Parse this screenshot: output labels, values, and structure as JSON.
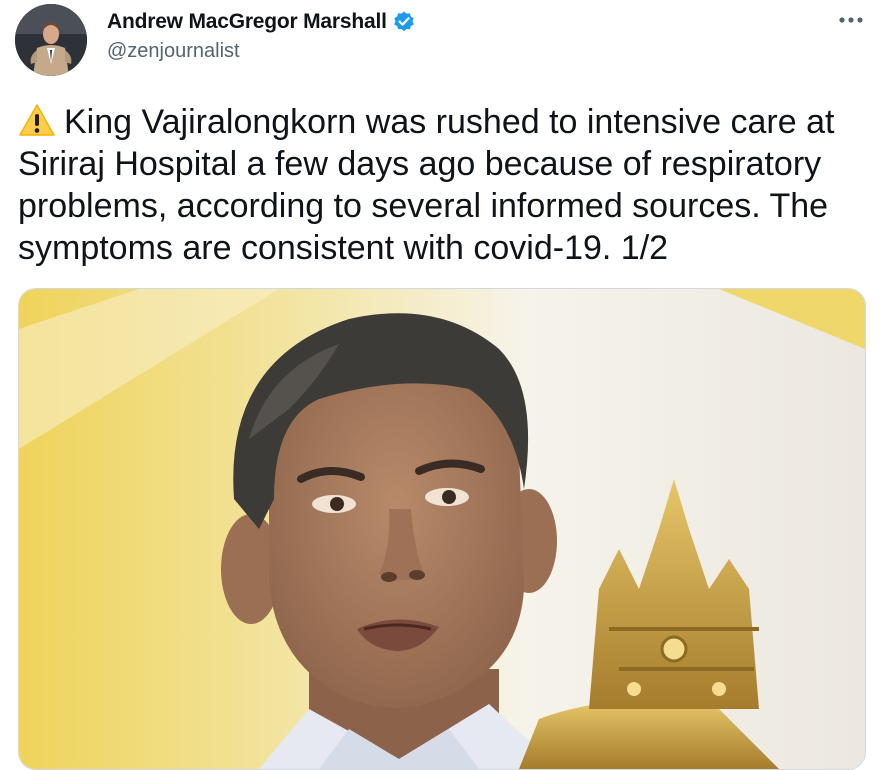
{
  "author": {
    "display_name": "Andrew MacGregor Marshall",
    "handle": "@zenjournalist",
    "verified": true,
    "avatar_icon": "profile-photo-man-in-suit"
  },
  "menu": {
    "more_icon": "more-horizontal-icon"
  },
  "tweet": {
    "warning_emoji": "warning-sign-icon",
    "text": "King Vajiralongkorn was rushed to intensive care at Siriraj Hospital a few days ago because of respiratory problems, according to several informed sources. The symptoms are consistent with covid-19. 1/2"
  },
  "media": {
    "type": "photo",
    "subject": "portrait-photo"
  },
  "colors": {
    "text_primary": "#0f1419",
    "text_secondary": "#536471",
    "verified_blue": "#1d9bf0",
    "warning_yellow": "#ffcc4d"
  }
}
